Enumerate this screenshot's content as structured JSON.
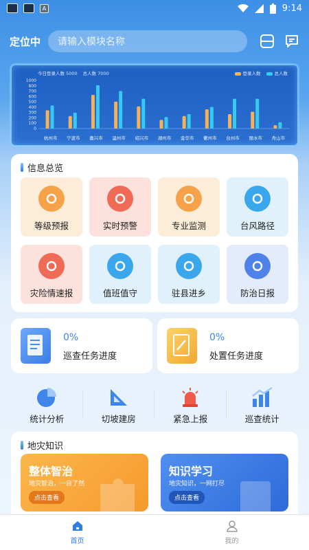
{
  "status": {
    "time": "9:14",
    "a_label": "A"
  },
  "header": {
    "location": "定位中",
    "search_placeholder": "请输入模块名称"
  },
  "chart_data": {
    "type": "bar",
    "caption_login": "今日登录人数 5000",
    "caption_total": "总人数 7000",
    "categories": [
      "杭州市",
      "宁波市",
      "嘉兴市",
      "温州市",
      "绍兴市",
      "湖州市",
      "金华市",
      "衢州市",
      "台州市",
      "丽水市",
      "舟山市"
    ],
    "series": [
      {
        "name": "登录人数",
        "color": "#f2b25c",
        "values": [
          380,
          260,
          700,
          560,
          460,
          180,
          260,
          400,
          300,
          350,
          70
        ]
      },
      {
        "name": "总人数",
        "color": "#38c9f0",
        "values": [
          480,
          330,
          900,
          780,
          620,
          240,
          300,
          450,
          620,
          620,
          130
        ]
      }
    ],
    "yticks": [
      "1000",
      "800",
      "700",
      "600",
      "500",
      "400",
      "300",
      "200",
      "100",
      "0"
    ],
    "ylim": [
      0,
      1000
    ]
  },
  "info": {
    "title": "信息总览",
    "tiles": [
      {
        "label": "等级预报",
        "icon": "triangle-icon",
        "bg": "#fdecd8",
        "circle": "#f6a24a"
      },
      {
        "label": "实时预警",
        "icon": "siren-icon",
        "bg": "#fde1dc",
        "circle": "#f06b55"
      },
      {
        "label": "专业监测",
        "icon": "monitor-icon",
        "bg": "#fdecd8",
        "circle": "#f6a24a"
      },
      {
        "label": "台风路径",
        "icon": "typhoon-icon",
        "bg": "#e0f1fc",
        "circle": "#3aa7ec"
      },
      {
        "label": "灾险情速报",
        "icon": "flame-icon",
        "bg": "#fde1dc",
        "circle": "#f06b55"
      },
      {
        "label": "值班值守",
        "icon": "person-clock-icon",
        "bg": "#e0f1fc",
        "circle": "#3aa7ec"
      },
      {
        "label": "驻县进乡",
        "icon": "people-icon",
        "bg": "#e0f1fc",
        "circle": "#3aa7ec"
      },
      {
        "label": "防治日报",
        "icon": "report-icon",
        "bg": "#e4ecfb",
        "circle": "#4f82e8"
      }
    ]
  },
  "tasks": [
    {
      "pct": "0%",
      "label": "巡查任务进度",
      "color": "#4a8ef0"
    },
    {
      "pct": "0%",
      "label": "处置任务进度",
      "color": "#f5b93a"
    }
  ],
  "quick": [
    {
      "label": "统计分析",
      "icon": "pie-chart-icon"
    },
    {
      "label": "切坡建房",
      "icon": "slope-icon"
    },
    {
      "label": "紧急上报",
      "icon": "alarm-icon"
    },
    {
      "label": "巡查统计",
      "icon": "bar-chart-icon"
    }
  ],
  "knowledge": {
    "title": "地灾知识",
    "cards": [
      {
        "title": "整体智治",
        "sub": "地灾智治，一目了然",
        "btn": "点击查看"
      },
      {
        "title": "知识学习",
        "sub": "地灾知识，一网打尽",
        "btn": "点击查看"
      }
    ]
  },
  "tabs": [
    {
      "label": "首页",
      "active": true
    },
    {
      "label": "我的",
      "active": false
    }
  ]
}
